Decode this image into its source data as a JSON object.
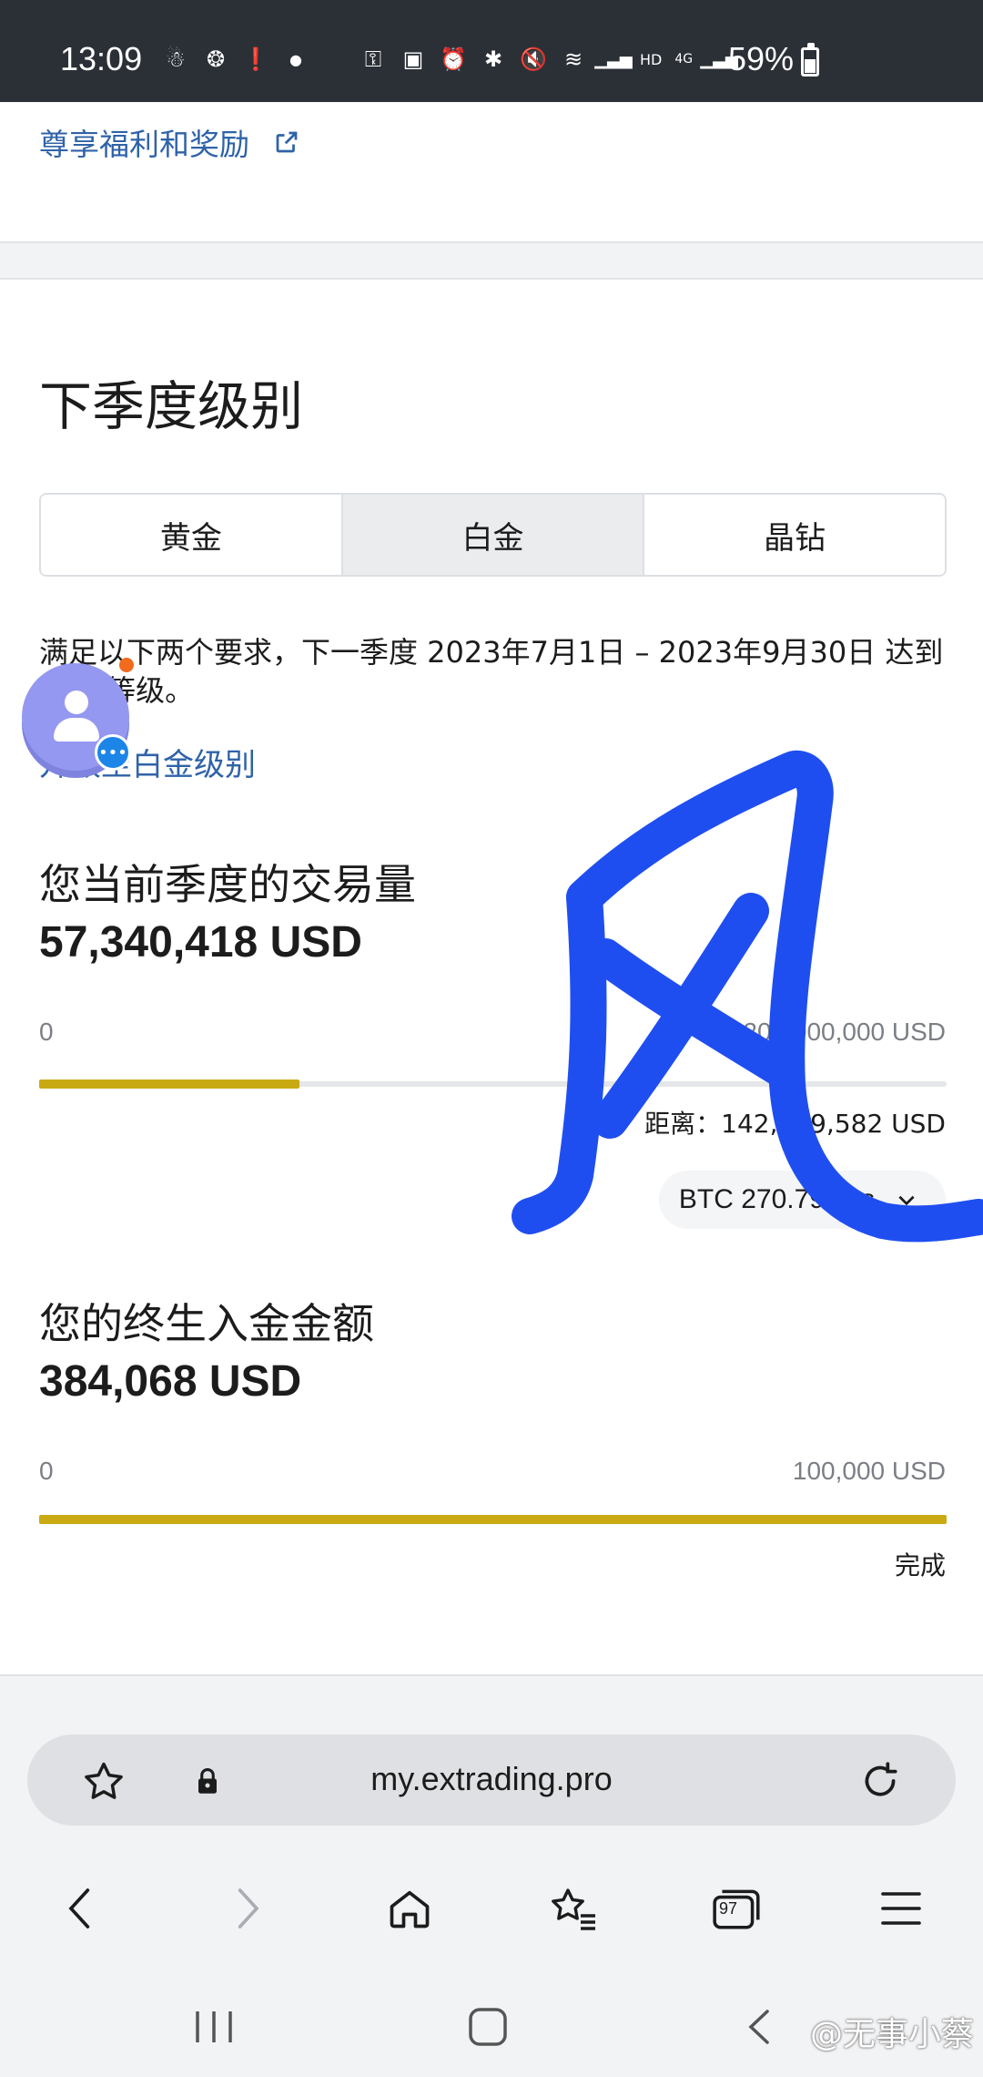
{
  "status_bar": {
    "time": "13:09",
    "battery": "59%",
    "network": "4G",
    "hd": "HD"
  },
  "benefits": {
    "link_label": "尊享福利和奖励"
  },
  "next_tier": {
    "title": "下季度级别",
    "tabs": [
      {
        "label": "黄金",
        "active": false
      },
      {
        "label": "白金",
        "active": true
      },
      {
        "label": "晶钻",
        "active": false
      }
    ],
    "requirement_text": "满足以下两个要求，下一季度 2023年7月1日 – 2023年9月30日 达到白金 等级。",
    "upgrade_link": "升级至白金级别"
  },
  "trading_volume": {
    "title": "您当前季度的交易量",
    "value": "57,340,418 USD",
    "range_min": "0",
    "range_max": "200,000,000 USD",
    "progress_percent": 28.7,
    "distance_text": "距离：142,659,582 USD",
    "lots_select": "BTC 270.79 lots"
  },
  "lifetime_deposit": {
    "title": "您的终生入金金额",
    "value": "384,068 USD",
    "range_min": "0",
    "range_max": "100,000 USD",
    "progress_percent": 100,
    "status": "完成"
  },
  "browser": {
    "url": "my.extrading.pro",
    "tabs_count": "97"
  },
  "watermark": "@无事小蔡",
  "colors": {
    "accent_link": "#2f63a8",
    "progress": "#c9aa12",
    "scribble": "#1f4ef0"
  }
}
